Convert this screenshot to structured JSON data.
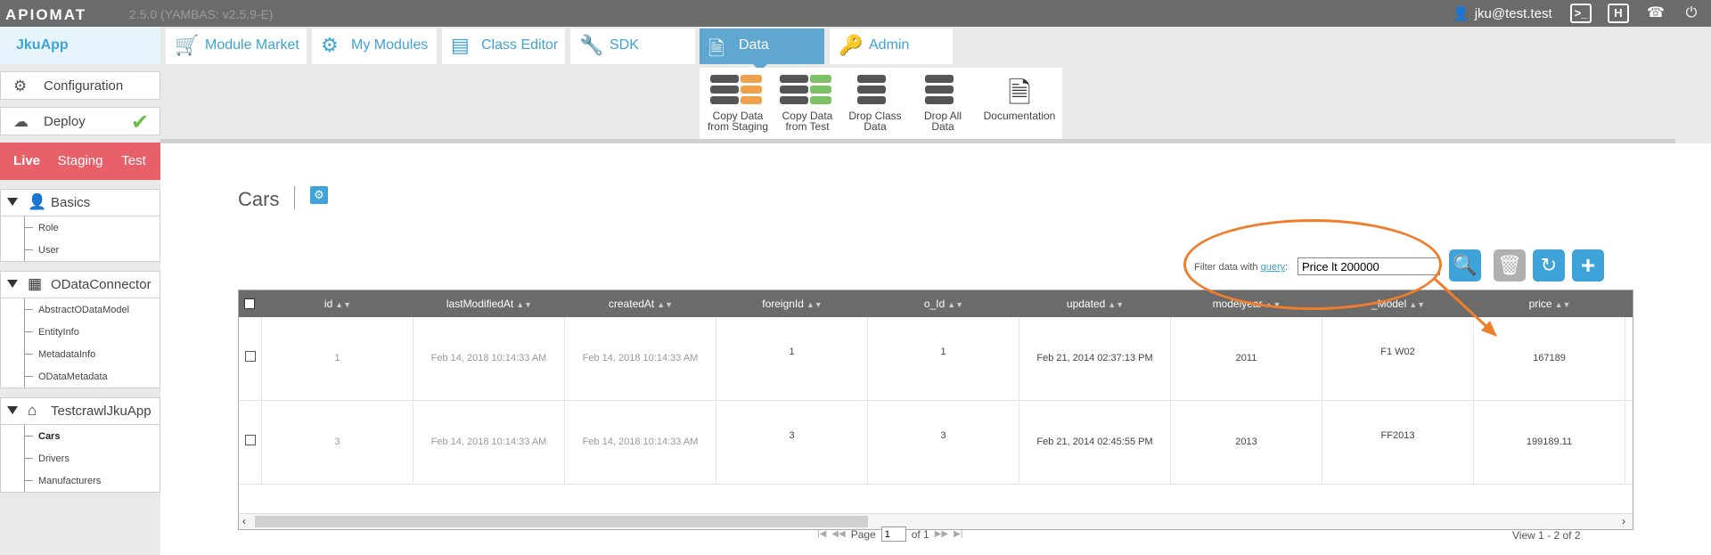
{
  "topbar": {
    "logo": "APIOMAT",
    "version": "2.5.0 (YAMBAS: v2.5.9-E)",
    "user": "jku@test.test"
  },
  "sidebar": {
    "app_name": "JkuApp",
    "configuration_label": "Configuration",
    "deploy_label": "Deploy",
    "env_tabs": [
      "Live",
      "Staging",
      "Test"
    ],
    "groups": [
      {
        "title": "Basics",
        "items": [
          "Role",
          "User"
        ]
      },
      {
        "title": "ODataConnector",
        "items": [
          "AbstractODataModel",
          "EntityInfo",
          "MetadataInfo",
          "ODataMetadata"
        ]
      },
      {
        "title": "TestcrawlJkuApp",
        "items": [
          "Cars",
          "Drivers",
          "Manufacturers"
        ]
      }
    ]
  },
  "tabs": [
    "Module Market",
    "My Modules",
    "Class Editor",
    "SDK",
    "Data",
    "Admin"
  ],
  "toolbar": {
    "copy_staging": [
      "Copy Data",
      "from Staging"
    ],
    "copy_test": [
      "Copy Data",
      "from Test"
    ],
    "drop_class": [
      "Drop Class",
      "Data"
    ],
    "drop_all": [
      "Drop All",
      "Data"
    ],
    "documentation": "Documentation"
  },
  "main": {
    "title": "Cars",
    "filter_label_prefix": "Filter data with",
    "filter_label_link": "query",
    "filter_label_suffix": ":",
    "filter_value": "Price lt 200000"
  },
  "table": {
    "columns": [
      "id",
      "lastModifiedAt",
      "createdAt",
      "foreignId",
      "o_Id",
      "updated",
      "modelyear",
      "_Model",
      "price"
    ],
    "rows": [
      {
        "id": "1",
        "lastModifiedAt": "Feb 14, 2018 10:14:33 AM",
        "createdAt": "Feb 14, 2018 10:14:33 AM",
        "foreignId": "1",
        "o_Id": "1",
        "updated": "Feb 21, 2014 02:37:13 PM",
        "modelyear": "2011",
        "model": "F1 W02",
        "price": "167189"
      },
      {
        "id": "3",
        "lastModifiedAt": "Feb 14, 2018 10:14:33 AM",
        "createdAt": "Feb 14, 2018 10:14:33 AM",
        "foreignId": "3",
        "o_Id": "3",
        "updated": "Feb 21, 2014 02:45:55 PM",
        "modelyear": "2013",
        "model": "FF2013",
        "price": "199189.11"
      }
    ]
  },
  "pager": {
    "page_label": "Page",
    "page_value": "1",
    "of_label": "of 1",
    "view_count": "View 1 - 2 of 2"
  },
  "colors": {
    "accent": "#3ea3d8",
    "active_tab": "#5fa6d1",
    "env_bar": "#e8616a",
    "annotation": "#f07d2a",
    "topbar": "#6b6b6b"
  }
}
